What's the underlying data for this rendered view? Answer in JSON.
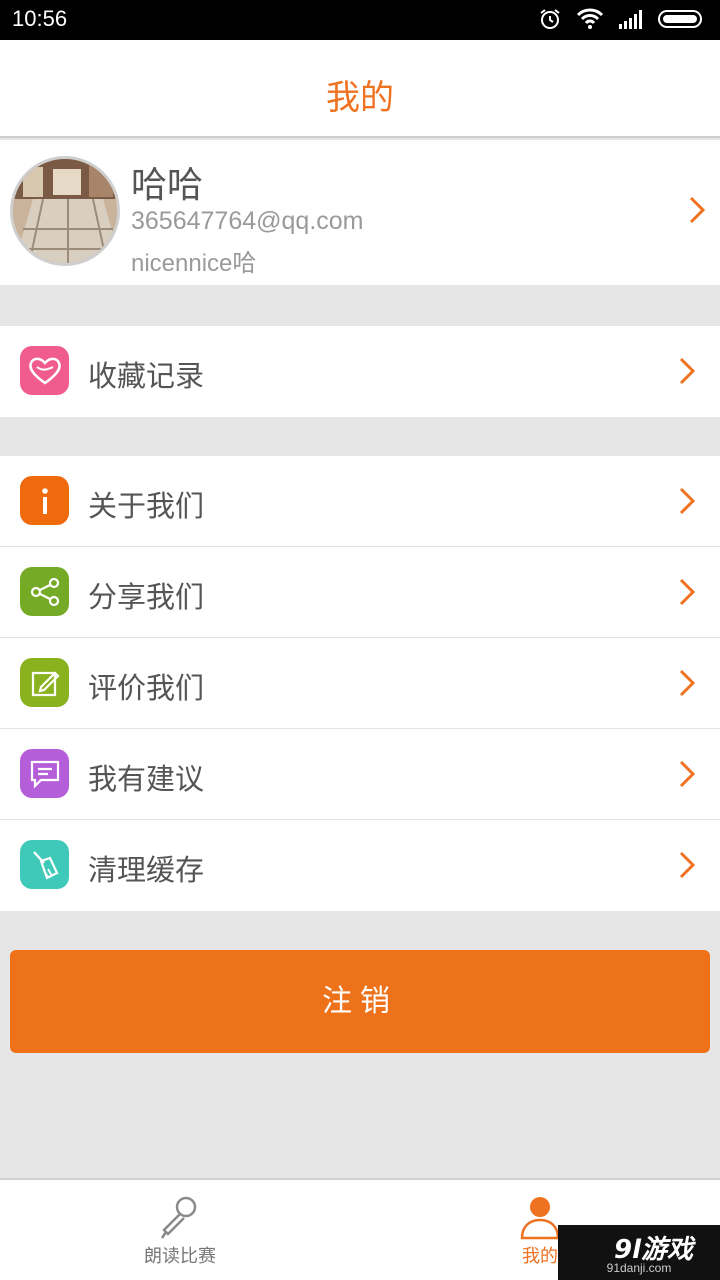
{
  "status_bar": {
    "time": "10:56",
    "icons": [
      "alarm-icon",
      "wifi-icon",
      "signal-icon",
      "battery-icon"
    ]
  },
  "header": {
    "title": "我的"
  },
  "profile": {
    "name": "哈哈",
    "email": "365647764@qq.com",
    "nickname": "nicennice哈"
  },
  "menu_groups": [
    [
      {
        "label": "收藏记录",
        "icon": "heart-icon",
        "color": "#f15c8e"
      }
    ],
    [
      {
        "label": "关于我们",
        "icon": "info-icon",
        "color": "#ee6a0c"
      },
      {
        "label": "分享我们",
        "icon": "share-icon",
        "color": "#74aa26"
      },
      {
        "label": "评价我们",
        "icon": "edit-icon",
        "color": "#8ab21f"
      },
      {
        "label": "我有建议",
        "icon": "message-icon",
        "color": "#b55ed9"
      },
      {
        "label": "清理缓存",
        "icon": "broom-icon",
        "color": "#3ec9b9"
      }
    ]
  ],
  "logout_button": {
    "label": "注销"
  },
  "tab_bar": {
    "tabs": [
      {
        "label": "朗读比赛",
        "icon": "microphone-icon",
        "active": false
      },
      {
        "label": "我的",
        "icon": "person-icon",
        "active": true
      }
    ]
  },
  "watermark": {
    "brand": "9l游戏",
    "domain": "91danji.com"
  },
  "colors": {
    "accent": "#ee7220",
    "background": "#e6e6e6"
  }
}
